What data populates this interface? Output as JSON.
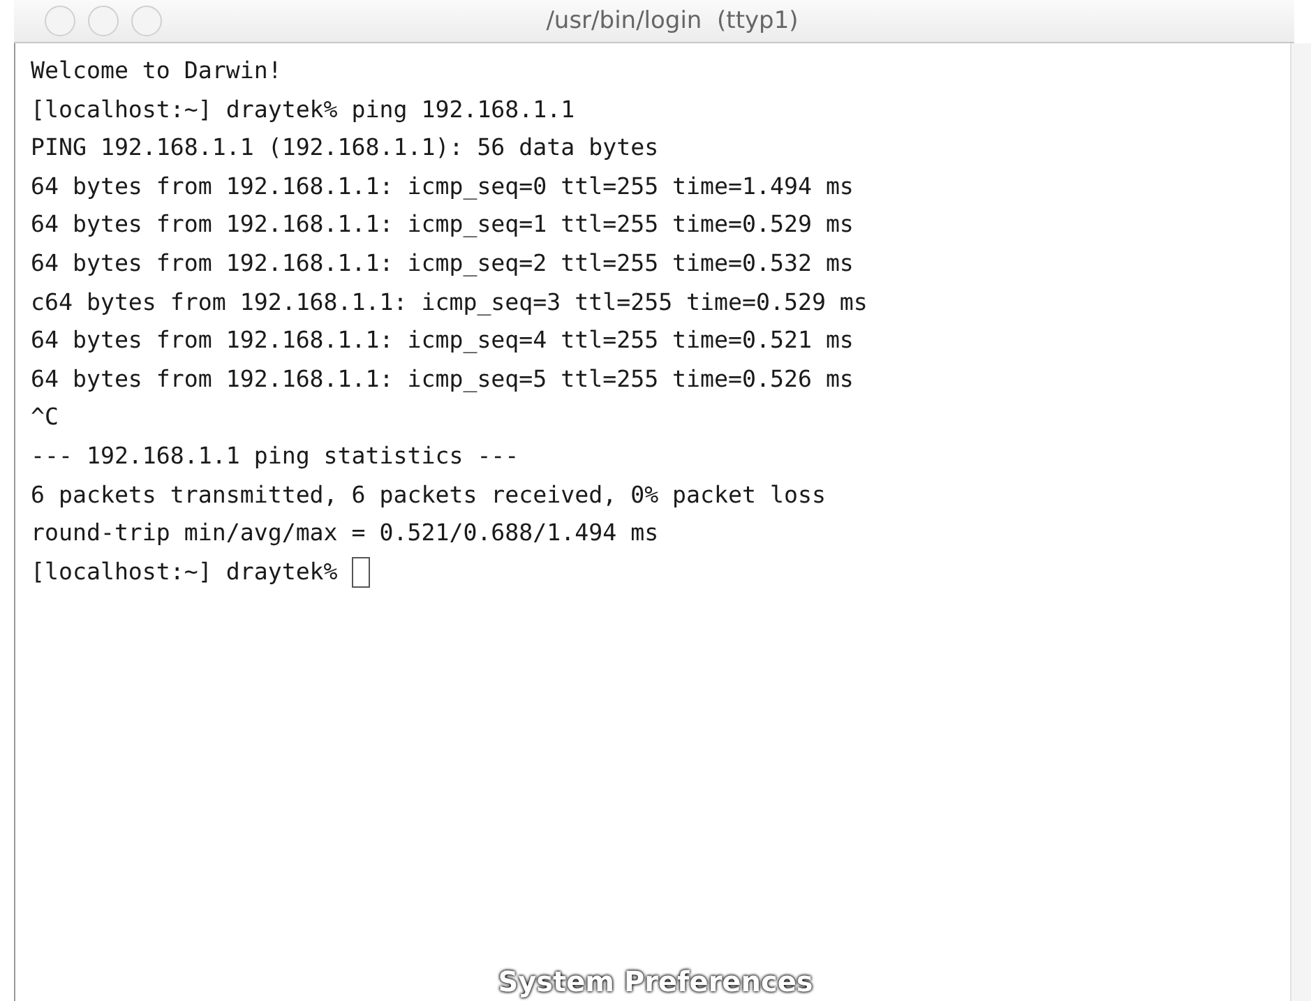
{
  "window": {
    "title": "/usr/bin/login  (ttyp1)"
  },
  "terminal": {
    "lines": [
      "Welcome to Darwin!",
      "[localhost:~] draytek% ping 192.168.1.1",
      "PING 192.168.1.1 (192.168.1.1): 56 data bytes",
      "64 bytes from 192.168.1.1: icmp_seq=0 ttl=255 time=1.494 ms",
      "64 bytes from 192.168.1.1: icmp_seq=1 ttl=255 time=0.529 ms",
      "64 bytes from 192.168.1.1: icmp_seq=2 ttl=255 time=0.532 ms",
      "c64 bytes from 192.168.1.1: icmp_seq=3 ttl=255 time=0.529 ms",
      "64 bytes from 192.168.1.1: icmp_seq=4 ttl=255 time=0.521 ms",
      "64 bytes from 192.168.1.1: icmp_seq=5 ttl=255 time=0.526 ms",
      "^C",
      "--- 192.168.1.1 ping statistics ---",
      "6 packets transmitted, 6 packets received, 0% packet loss",
      "round-trip min/avg/max = 0.521/0.688/1.494 ms"
    ],
    "prompt": "[localhost:~] draytek%"
  },
  "dock_label": "System Preferences"
}
